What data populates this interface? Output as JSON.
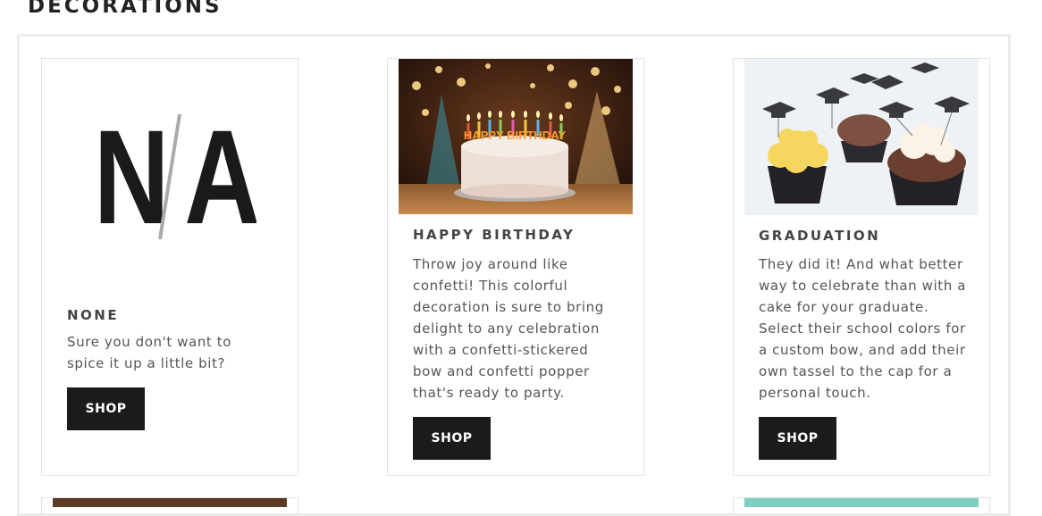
{
  "section": {
    "title": "DECORATIONS"
  },
  "cards": [
    {
      "logo_text": "N/A",
      "title": "NONE",
      "description": "Sure you don't want to spice it up a little bit?",
      "button": "SHOP"
    },
    {
      "image": "birthday-cake-photo",
      "cake_candle_text": "HAPPY BIRTHDAY",
      "title": "HAPPY BIRTHDAY",
      "description": "Throw joy around like confetti! This colorful decoration is sure to bring delight to any celebration with a confetti-stickered bow and confetti popper that's ready to party.",
      "button": "SHOP"
    },
    {
      "image": "graduation-cupcakes-photo",
      "title": "GRADUATION",
      "description": "They did it! And what better way to celebrate than with a cake for your graduate. Select their school colors for a custom bow, and add their own tassel to the cap for a personal touch.",
      "button": "SHOP"
    }
  ],
  "colors": {
    "button_bg": "#1b1b1b",
    "button_text": "#ffffff",
    "card_border": "#e3e3e3",
    "panel_border": "#ececec"
  }
}
